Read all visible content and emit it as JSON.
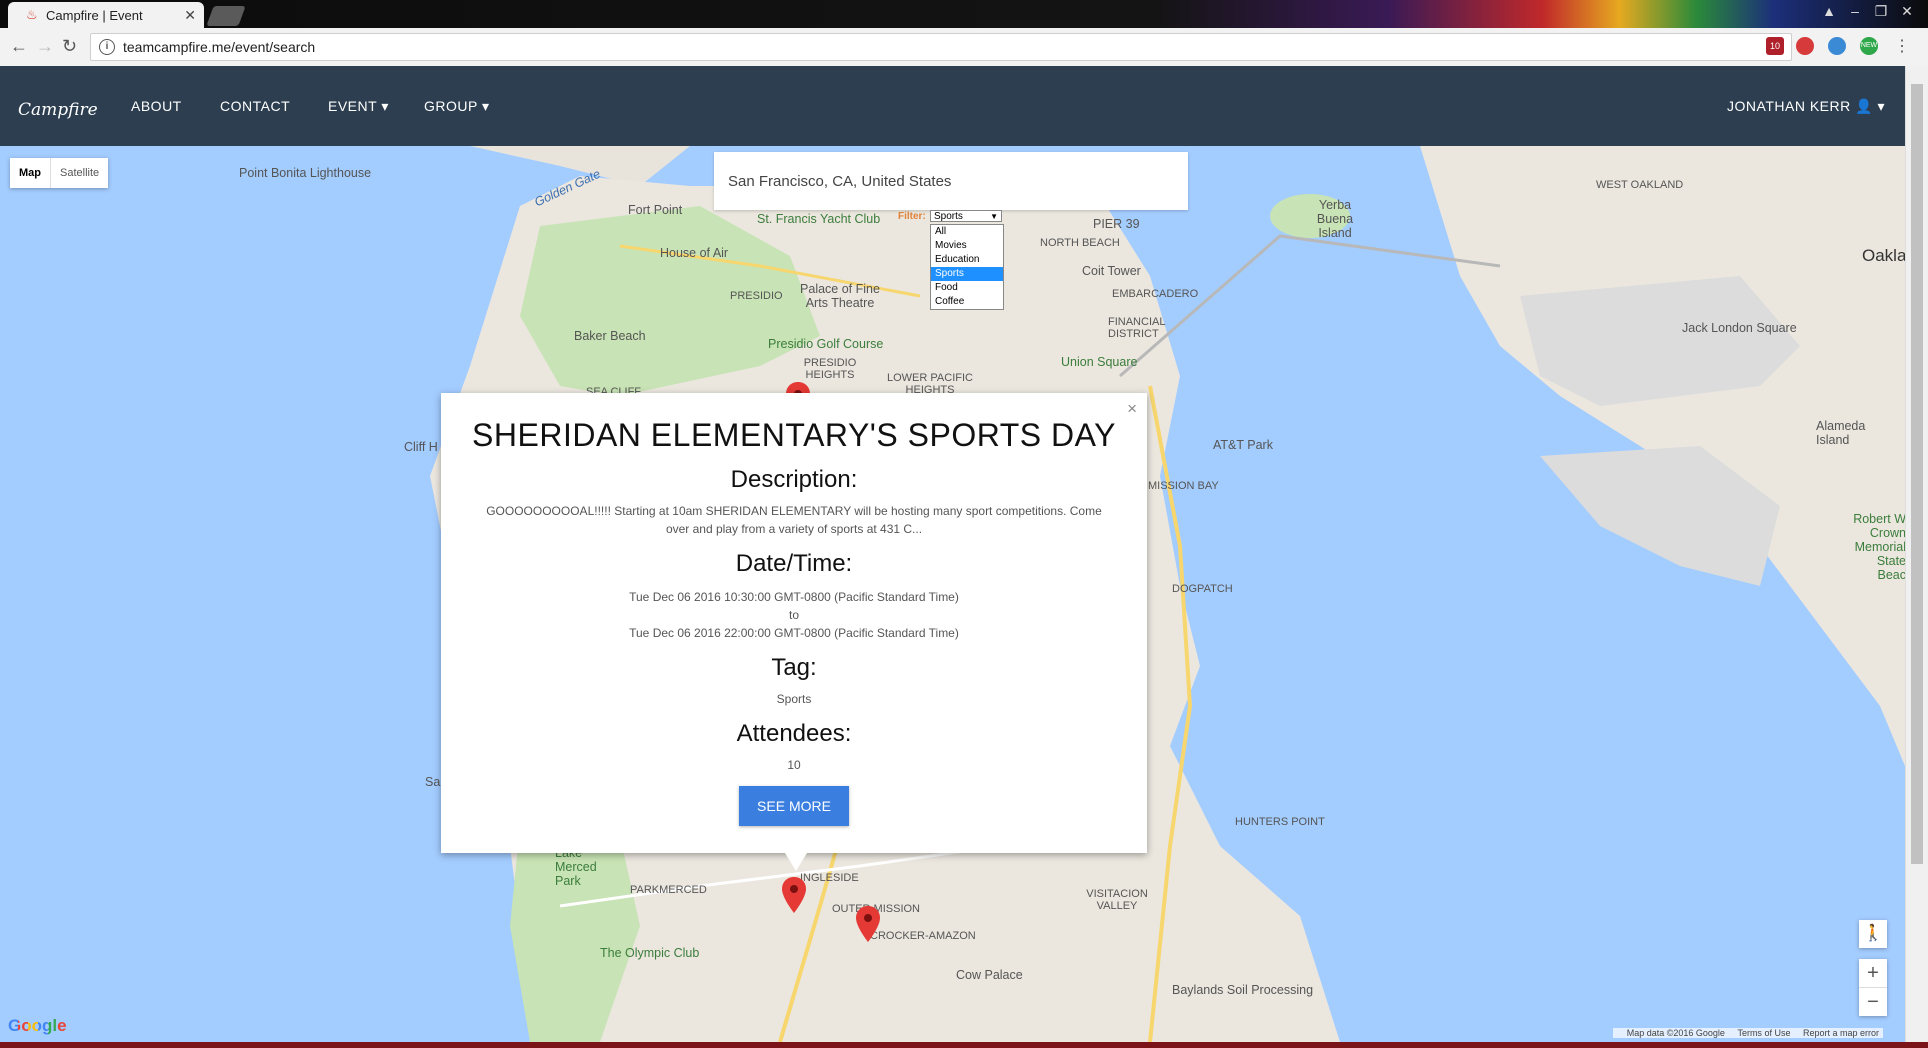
{
  "browser": {
    "tab_title": "Campfire | Event",
    "url": "teamcampfire.me/event/search",
    "extension_badge": "10",
    "extension_new": "NEW"
  },
  "navbar": {
    "logo": "Campfire",
    "links": [
      "ABOUT",
      "CONTACT",
      "EVENT",
      "GROUP"
    ],
    "user": "JONATHAN KERR"
  },
  "map": {
    "type_controls": [
      "Map",
      "Satellite"
    ],
    "search_value": "San Francisco, CA, United States",
    "filter": {
      "label": "Filter:",
      "selected": "Sports",
      "options": [
        "All",
        "Movies",
        "Education",
        "Sports",
        "Food",
        "Coffee"
      ]
    },
    "labels": {
      "point_bonita": "Point Bonita Lighthouse",
      "golden_gate": "Golden Gate",
      "fort_point": "Fort Point",
      "yacht_club": "St. Francis Yacht Club",
      "pier39": "PIER 39",
      "north_beach": "NORTH BEACH",
      "coit_tower": "Coit Tower",
      "embarcadero": "EMBARCADERO",
      "financial": "FINANCIAL DISTRICT",
      "house_of_air": "House of Air",
      "presidio": "PRESIDIO",
      "fine_arts": "Palace of Fine Arts Theatre",
      "baker_beach": "Baker Beach",
      "presidio_golf": "Presidio Golf Course",
      "presidio_heights": "PRESIDIO HEIGHTS",
      "lower_pacific": "LOWER PACIFIC HEIGHTS",
      "union_square": "Union Square",
      "sea_cliff": "SEA CLIFF",
      "cliff_h": "Cliff H",
      "att_park": "AT&T Park",
      "mission_bay": "MISSION BAY",
      "dogpatch": "DOGPATCH",
      "hunters_point": "HUNTERS POINT",
      "yerba_buena": "Yerba Buena Island",
      "west_oakland": "WEST OAKLAND",
      "oakland": "Oakla",
      "jack_london": "Jack London Square",
      "alameda": "Alameda Island",
      "robert_crown": "Robert W Crown Memorial State Beac",
      "lake_merced": "Lake Merced Park",
      "parkmerced": "PARKMERCED",
      "ingleside": "INGLESIDE",
      "outer_mission": "OUTER MISSION",
      "crocker": "CROCKER-AMAZON",
      "visitacion": "VISITACION VALLEY",
      "olympic_club": "The Olympic Club",
      "cow_palace": "Cow Palace",
      "baylands": "Baylands Soil Processing",
      "sa": "Sa"
    },
    "zoom_in": "+",
    "zoom_out": "−",
    "google": "Google",
    "attribution": [
      "Map data ©2016 Google",
      "Terms of Use",
      "Report a map error"
    ]
  },
  "event_popup": {
    "title": "SHERIDAN ELEMENTARY'S SPORTS DAY",
    "description_heading": "Description:",
    "description": "GOOOOOOOOOAL!!!!! Starting at 10am SHERIDAN ELEMENTARY will be hosting many sport competitions. Come over and play from a variety of sports at 431 C...",
    "datetime_heading": "Date/Time:",
    "start": "Tue Dec 06 2016 10:30:00 GMT-0800 (Pacific Standard Time)",
    "to": "to",
    "end": "Tue Dec 06 2016 22:00:00 GMT-0800 (Pacific Standard Time)",
    "tag_heading": "Tag:",
    "tag": "Sports",
    "attendees_heading": "Attendees:",
    "attendees": "10",
    "button": "SEE MORE",
    "close": "×"
  }
}
